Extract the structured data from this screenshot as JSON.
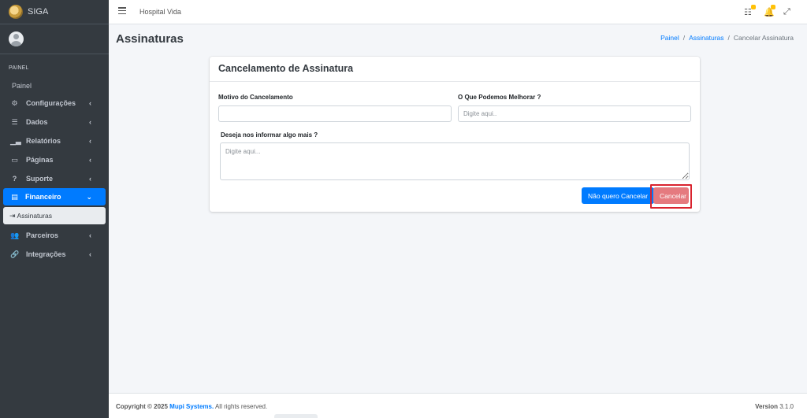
{
  "brand": {
    "name": "SIGA"
  },
  "sidebar": {
    "header": "PAINEL",
    "painel_link": "Painel",
    "items": [
      {
        "label": "Configurações",
        "icon": "cogs-icon"
      },
      {
        "label": "Dados",
        "icon": "database-icon"
      },
      {
        "label": "Relatórios",
        "icon": "chart-icon"
      },
      {
        "label": "Páginas",
        "icon": "desktop-icon"
      },
      {
        "label": "Suporte",
        "icon": "question-icon"
      },
      {
        "label": "Financeiro",
        "icon": "wallet-icon"
      },
      {
        "label": "Parceiros",
        "icon": "users-icon"
      },
      {
        "label": "Integrações",
        "icon": "link-icon"
      }
    ],
    "sub_item": {
      "label": "Assinaturas",
      "icon": "sign-in-icon"
    }
  },
  "topbar": {
    "org_name": "Hospital Vida"
  },
  "page": {
    "title": "Assinaturas",
    "breadcrumb": [
      "Painel",
      "Assinaturas",
      "Cancelar Assinatura"
    ]
  },
  "form": {
    "card_title": "Cancelamento de Assinatura",
    "reason_label": "Motivo do Cancelamento",
    "reason_value": "",
    "improve_label": "O Que Podemos Melhorar ?",
    "improve_placeholder": "Digite aqui..",
    "more_label": "Deseja nos informar algo mais ?",
    "more_placeholder": "Digite aqui...",
    "keep_button": "Não quero Cancelar",
    "cancel_button": "Cancelar"
  },
  "footer": {
    "copyright": "Copyright © 2025",
    "company": "Mupi Systems.",
    "rights": "All rights reserved.",
    "version_label": "Version",
    "version_value": "3.1.0"
  },
  "colors": {
    "sidebar_bg": "#343a40",
    "primary": "#007bff",
    "danger": "#e57a7f",
    "highlight": "#d9232e",
    "badge": "#ffc107"
  }
}
